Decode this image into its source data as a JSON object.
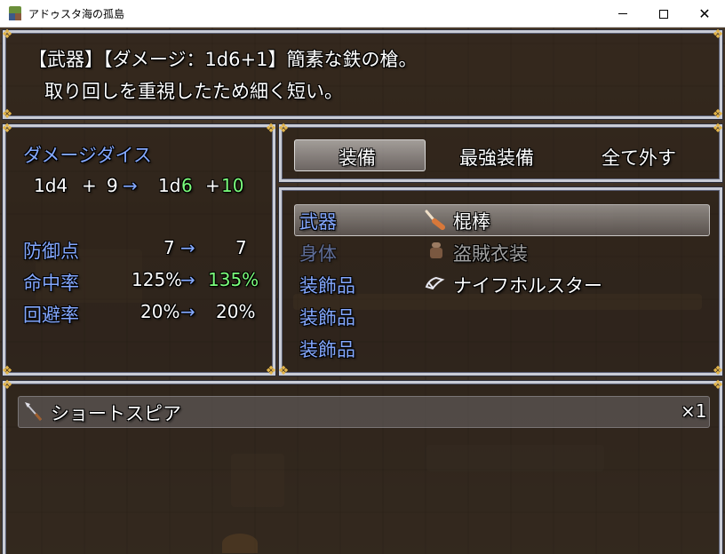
{
  "window": {
    "title": "アドゥスタ海の孤島",
    "minimize": "—",
    "maximize": "□",
    "close": "✕"
  },
  "help": {
    "line1": "【武器】【ダメージ：1d6+1】簡素な鉄の槍。",
    "line2": "取り回しを重視したため細く短い。"
  },
  "status": {
    "damage_label": "ダメージダイス",
    "dice": {
      "cur_a": "1d4",
      "plus1": "+",
      "cur_b": "9",
      "arrow": "→",
      "new_a": "1d",
      "new_a_num": "6",
      "plus2": "+",
      "new_b": "10"
    },
    "rows": [
      {
        "label": "防御点",
        "cur": "7",
        "arrow": "→",
        "new": "7",
        "improved": false
      },
      {
        "label": "命中率",
        "cur": "125%",
        "arrow": "→",
        "new": "135%",
        "improved": true
      },
      {
        "label": "回避率",
        "cur": "20%",
        "arrow": "→",
        "new": "20%",
        "improved": false
      }
    ]
  },
  "commands": {
    "equip": "装備",
    "optimize": "最強装備",
    "clear": "全て外す",
    "selected": "equip"
  },
  "slots": [
    {
      "slot": "武器",
      "item": "棍棒",
      "icon": "club-icon",
      "selected": true,
      "enabled": true
    },
    {
      "slot": "身体",
      "item": "盗賊衣装",
      "icon": "clothes-icon",
      "selected": false,
      "enabled": false
    },
    {
      "slot": "装飾品",
      "item": "ナイフホルスター",
      "icon": "holster-icon",
      "selected": false,
      "enabled": true
    },
    {
      "slot": "装飾品",
      "item": "",
      "icon": "",
      "selected": false,
      "enabled": true
    },
    {
      "slot": "装飾品",
      "item": "",
      "icon": "",
      "selected": false,
      "enabled": true
    }
  ],
  "items": [
    {
      "name": "ショートスピア",
      "count": "×1",
      "icon": "spear-icon"
    }
  ],
  "colors": {
    "system_blue": "#84a8ff",
    "power_up": "#7cff7c",
    "disabled": "#a0a0a0",
    "window_border": "#c9ccd6",
    "corner_ornament": "#e3b54a"
  }
}
